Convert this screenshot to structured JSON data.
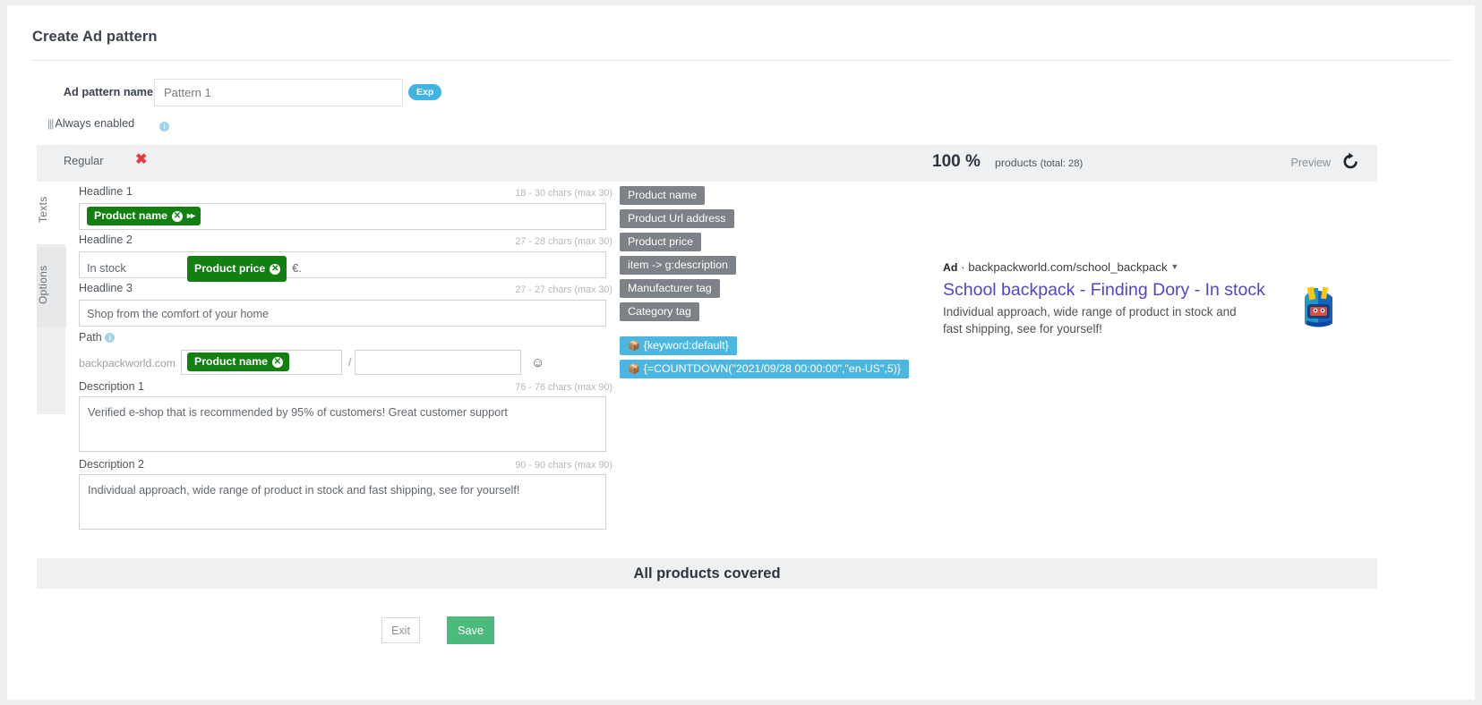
{
  "header": {
    "title": "Create Ad pattern"
  },
  "pattern": {
    "label": "Ad pattern name",
    "value": "Pattern 1",
    "badge": "Exp",
    "always_enabled": "Always enabled"
  },
  "tabstrip": {
    "tab_label": "Regular",
    "close_icon": "✖",
    "percent": "100 %",
    "products_text": "products",
    "products_total": "(total: 28)",
    "preview_label": "Preview"
  },
  "vtabs": {
    "texts": "Texts",
    "options": "Options"
  },
  "fields": {
    "headline1": {
      "label": "Headline 1",
      "counter": "18 - 30 chars (max 30)",
      "chip": "Product name",
      "text": ""
    },
    "headline2": {
      "label": "Headline 2",
      "counter": "27 - 28 chars (max 30)",
      "prefix": "In stock",
      "chip": "Product price",
      "suffix": "€."
    },
    "headline3": {
      "label": "Headline 3",
      "counter": "27 - 27 chars (max 30)",
      "text": "Shop from the comfort of your home"
    },
    "path": {
      "label": "Path",
      "host": "backpackworld.com",
      "chip": "Product name",
      "separator": "/",
      "second_value": ""
    },
    "description1": {
      "label": "Description 1",
      "counter": "76 - 76 chars (max 90)",
      "text": "Verified e-shop that is recommended by 95% of customers! Great customer support"
    },
    "description2": {
      "label": "Description 2",
      "counter": "90 - 90 chars (max 90)",
      "text": "Individual approach, wide range of product in stock and fast shipping, see for yourself!"
    }
  },
  "tags": {
    "gray": [
      "Product name",
      "Product Url address",
      "Product price",
      "item -> g:description",
      "Manufacturer tag",
      "Category tag"
    ],
    "blue": [
      "{keyword:default}",
      "{=COUNTDOWN(\"2021/09/28 00:00:00\",\"en-US\",5)}"
    ]
  },
  "preview": {
    "ad_badge": "Ad",
    "url": "· backpackworld.com/school_backpack",
    "title": "School backpack - Finding Dory - In stock",
    "description": "Individual approach, wide range of product in stock and fast shipping, see for yourself!"
  },
  "footer": {
    "covered": "All products covered",
    "exit": "Exit",
    "save": "Save"
  },
  "colors": {
    "chip_green": "#118011",
    "tag_gray": "#7c8287",
    "tag_blue": "#4bb6e0",
    "save_green": "#4cba7c",
    "serp_title": "#5145c9",
    "badge_blue": "#3fb4e5"
  }
}
